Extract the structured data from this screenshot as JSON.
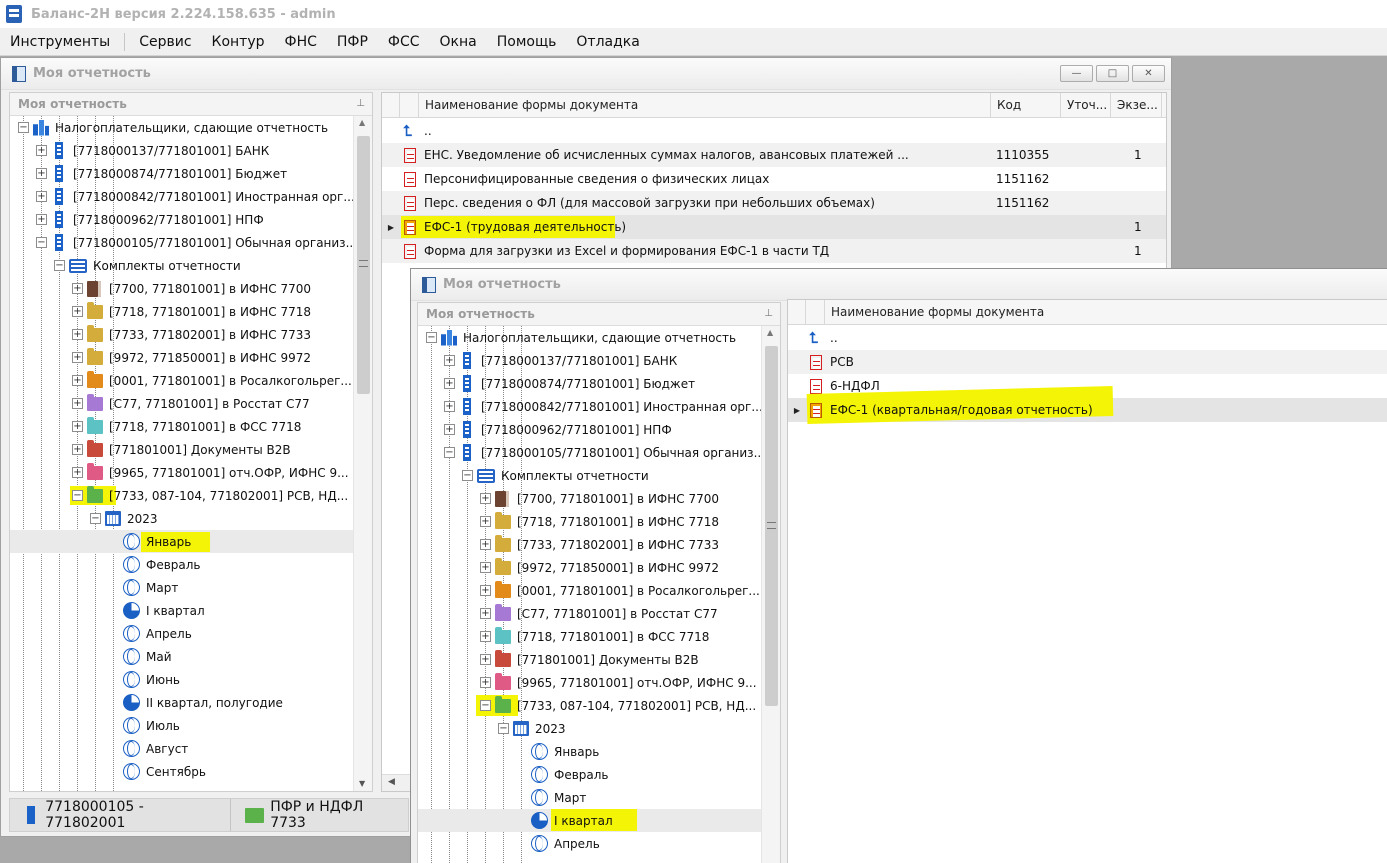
{
  "app": {
    "title": "Баланс-2Н версия 2.224.158.635 - admin"
  },
  "menu": [
    "Инструменты",
    "Сервис",
    "Контур",
    "ФНС",
    "ПФР",
    "ФСС",
    "Окна",
    "Помощь",
    "Отладка"
  ],
  "colors": {
    "highlight": "#f4f406",
    "accent_blue": "#1a62c8",
    "doc_red": "#d42020",
    "folder_brown": "#6b4330",
    "folder_yellow": "#d4ac3c",
    "folder_orange": "#e28a1a",
    "folder_purple": "#a579d4",
    "folder_teal": "#5cc2c4",
    "folder_red": "#c84a3a",
    "folder_pink": "#e05a86",
    "folder_green": "#5cb24a"
  },
  "win1": {
    "title": "Моя отчетность",
    "buttons": [
      "—",
      "□",
      "✕"
    ],
    "tree_caption": "Моя отчетность",
    "tree": [
      {
        "label": "Налогоплательщики, сдающие отчетность",
        "icon": "buildings-icon"
      },
      {
        "label": "[7718000137/771801001] БАНК",
        "icon": "org-icon"
      },
      {
        "label": "[7718000874/771801001] Бюджет",
        "icon": "org-icon"
      },
      {
        "label": "[7718000842/771801001] Иностранная орг...",
        "icon": "org-icon"
      },
      {
        "label": "[7718000962/771801001] НПФ",
        "icon": "org-icon"
      },
      {
        "label": "[7718000105/771801001] Обычная организ...",
        "icon": "org-icon"
      },
      {
        "label": "Комплекты отчетности",
        "icon": "kits-icon"
      },
      {
        "label": "[7700, 771801001] в ИФНС 7700",
        "icon": "book-icon"
      },
      {
        "label": "[7718, 771801001] в ИФНС 7718",
        "icon": "folder-icon"
      },
      {
        "label": "[7733, 771802001] в ИФНС 7733",
        "icon": "folder-icon"
      },
      {
        "label": "[9972, 771850001] в ИФНС 9972",
        "icon": "folder-icon"
      },
      {
        "label": "[0001, 771801001] в Росалкогольрег...",
        "icon": "folder-icon"
      },
      {
        "label": "[C77, 771801001] в Росстат C77",
        "icon": "folder-icon"
      },
      {
        "label": "[7718, 771801001] в ФСС 7718",
        "icon": "folder-icon"
      },
      {
        "label": "[771801001] Документы B2B",
        "icon": "folder-icon"
      },
      {
        "label": "[9965, 771801001] отч.ОФР, ИФНС 9...",
        "icon": "folder-icon"
      },
      {
        "label": "[7733, 087-104, 771802001] РСВ, НД...",
        "icon": "folder-icon"
      },
      {
        "label": "2023",
        "icon": "calendar-icon"
      },
      {
        "label": "Январь",
        "icon": "month-icon"
      },
      {
        "label": "Февраль",
        "icon": "month-icon"
      },
      {
        "label": "Март",
        "icon": "month-icon"
      },
      {
        "label": "I квартал",
        "icon": "quarter-icon"
      },
      {
        "label": "Апрель",
        "icon": "month-icon"
      },
      {
        "label": "Май",
        "icon": "month-icon"
      },
      {
        "label": "Июнь",
        "icon": "month-icon"
      },
      {
        "label": "II квартал, полугодие",
        "icon": "quarter-icon"
      },
      {
        "label": "Июль",
        "icon": "month-icon"
      },
      {
        "label": "Август",
        "icon": "month-icon"
      },
      {
        "label": "Сентябрь",
        "icon": "month-icon"
      }
    ],
    "grid": {
      "columns": [
        "Наименование формы документа",
        "Код",
        "Уточ...",
        "Экзе..."
      ],
      "up_row": "..",
      "rows": [
        {
          "name": "ЕНС. Уведомление об исчисленных суммах налогов, авансовых платежей ...",
          "code": "1110355",
          "copies": "1"
        },
        {
          "name": "Персонифицированные сведения о физических лицах",
          "code": "1151162",
          "copies": ""
        },
        {
          "name": "Перс. сведения о ФЛ (для массовой загрузки при небольших объемах)",
          "code": "1151162",
          "copies": ""
        },
        {
          "name": "ЕФС-1 (трудовая деятельность)",
          "code": "",
          "copies": "1"
        },
        {
          "name": "Форма для загрузки из Excel и формирования ЕФС-1 в части ТД",
          "code": "",
          "copies": "1"
        }
      ]
    },
    "status": {
      "org": "7718000105 - 771802001",
      "kit": "ПФР и НДФЛ 7733"
    }
  },
  "win2": {
    "title": "Моя отчетность",
    "tree_caption": "Моя отчетность",
    "tree": [
      {
        "label": "Налогоплательщики, сдающие отчетность"
      },
      {
        "label": "[7718000137/771801001] БАНК"
      },
      {
        "label": "[7718000874/771801001] Бюджет"
      },
      {
        "label": "[7718000842/771801001] Иностранная орг..."
      },
      {
        "label": "[7718000962/771801001] НПФ"
      },
      {
        "label": "[7718000105/771801001] Обычная организ..."
      },
      {
        "label": "Комплекты отчетности"
      },
      {
        "label": "[7700, 771801001] в ИФНС 7700"
      },
      {
        "label": "[7718, 771801001] в ИФНС 7718"
      },
      {
        "label": "[7733, 771802001] в ИФНС 7733"
      },
      {
        "label": "[9972, 771850001] в ИФНС 9972"
      },
      {
        "label": "[0001, 771801001] в Росалкогольрег..."
      },
      {
        "label": "[C77, 771801001] в Росстат C77"
      },
      {
        "label": "[7718, 771801001] в ФСС 7718"
      },
      {
        "label": "[771801001] Документы B2B"
      },
      {
        "label": "[9965, 771801001] отч.ОФР, ИФНС 9..."
      },
      {
        "label": "[7733, 087-104, 771802001] РСВ, НД..."
      },
      {
        "label": "2023"
      },
      {
        "label": "Январь"
      },
      {
        "label": "Февраль"
      },
      {
        "label": "Март"
      },
      {
        "label": "I квартал"
      },
      {
        "label": "Апрель"
      }
    ],
    "grid": {
      "columns": [
        "Наименование формы документа"
      ],
      "up_row": "..",
      "rows": [
        {
          "name": "РСВ"
        },
        {
          "name": "6-НДФЛ"
        },
        {
          "name": "ЕФС-1 (квартальная/годовая отчетность)"
        }
      ]
    }
  }
}
